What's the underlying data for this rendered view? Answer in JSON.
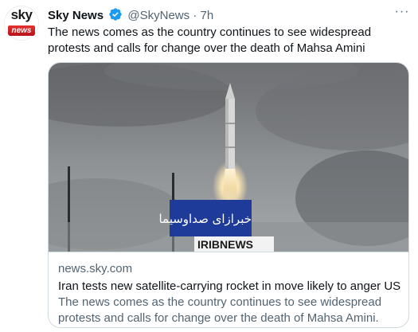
{
  "account": {
    "avatar_top": "sky",
    "avatar_bottom": "news",
    "display_name": "Sky News",
    "handle": "@SkyNews",
    "separator": "·",
    "time": "7h",
    "verified_icon": "verified-badge-icon",
    "verified_color": "#1d9bf0"
  },
  "tweet": {
    "text": "The news comes as the country continues to see widespread protests and calls for change over the death of Mahsa Amini",
    "more_icon": "ellipsis-icon",
    "more_label": "···"
  },
  "card": {
    "overlay_arabic": "خبرازای صداوسیما",
    "overlay_label": "IRIBNEWS",
    "domain": "news.sky.com",
    "title": "Iran tests new satellite-carrying rocket in move likely to anger US",
    "description": "The news comes as the country continues to see widespread protests and calls for change over the death of Mahsa Amini."
  },
  "colors": {
    "text": "#0f1419",
    "muted": "#536471",
    "border": "#cfd9de",
    "overlay_blue": "#1f3b9a"
  }
}
